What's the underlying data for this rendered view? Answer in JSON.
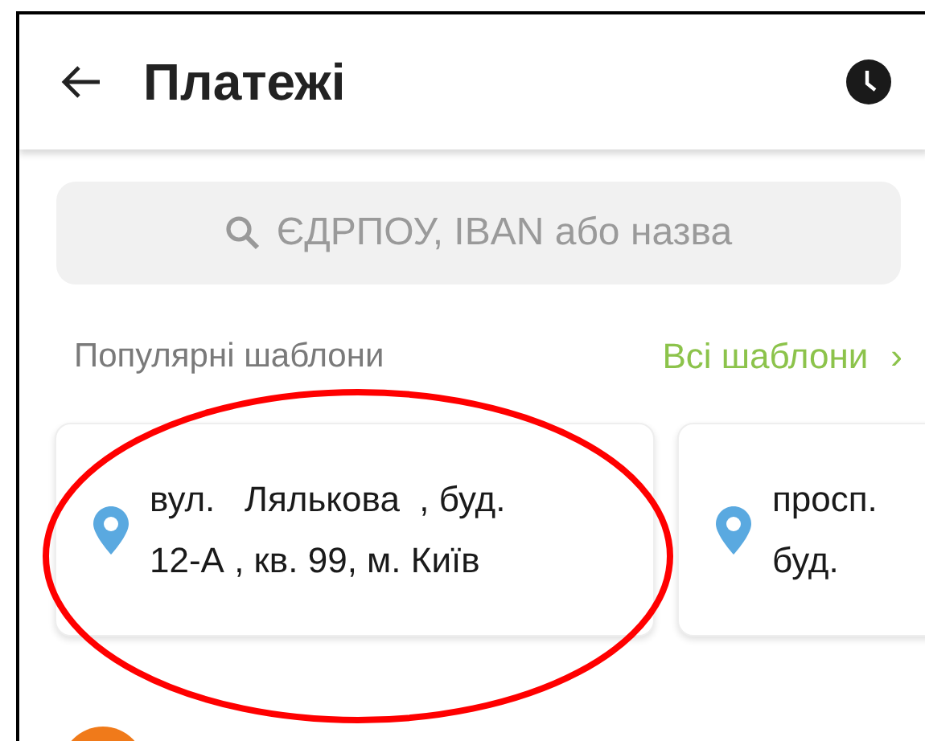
{
  "header": {
    "title": "Платежі"
  },
  "search": {
    "placeholder": "ЄДРПОУ, IBAN або назва"
  },
  "templates": {
    "title": "Популярні шаблони",
    "link": "Всі шаблони",
    "link_arrow": "›"
  },
  "cards": [
    {
      "lines": [
        "вул.   Лялькова  , буд.",
        "12-А , кв. 99, м. Київ"
      ]
    },
    {
      "lines": [
        "просп.",
        "буд."
      ]
    }
  ]
}
